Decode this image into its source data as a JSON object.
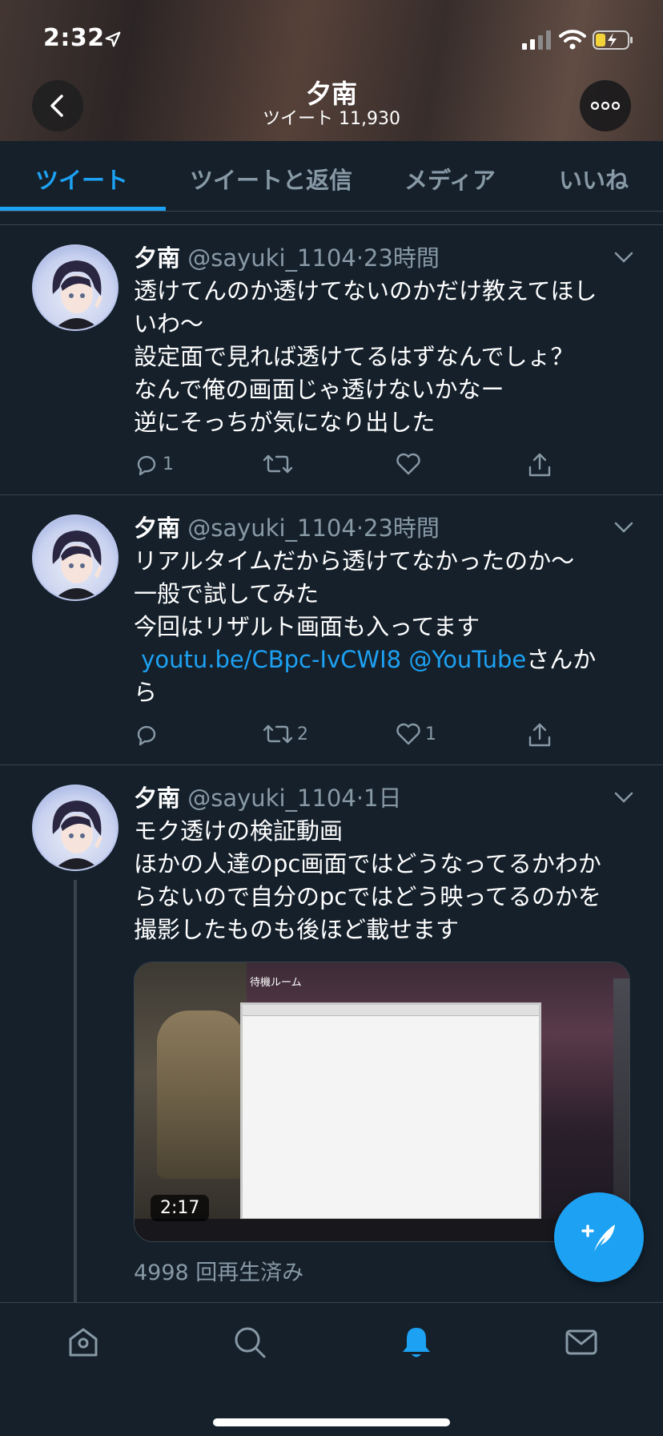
{
  "status_bar": {
    "time": "2:32"
  },
  "profile": {
    "name": "夕南",
    "tweet_count_label": "ツイート 11,930"
  },
  "tabs": [
    {
      "label": "ツイート",
      "active": true
    },
    {
      "label": "ツイートと返信",
      "active": false
    },
    {
      "label": "メディア",
      "active": false
    },
    {
      "label": "いいね",
      "active": false
    }
  ],
  "tweets": [
    {
      "name": "夕南",
      "handle": "@sayuki_1104",
      "time": "23時間",
      "lines": [
        "透けてんのか透けてないのかだけ教えてほし",
        "いわ〜",
        "設定面で見れば透けてるはずなんでしょ？",
        "なんで俺の画面じゃ透けないかなー",
        "逆にそっちが気になり出した"
      ],
      "replies": "1",
      "retweets": "",
      "likes": ""
    },
    {
      "name": "夕南",
      "handle": "@sayuki_1104",
      "time": "23時間",
      "lines": [
        "リアルタイムだから透けてなかったのか〜",
        "一般で試してみた",
        "今回はリザルト画面も入ってます"
      ],
      "link_line": {
        "link1": "youtu.be/CBpc-IvCWI8",
        "link2": "@YouTube",
        "suffix": "さんか"
      },
      "last_line": "ら",
      "replies": "",
      "retweets": "2",
      "likes": "1"
    },
    {
      "name": "夕南",
      "handle": "@sayuki_1104",
      "time": "1日",
      "lines": [
        "モク透けの検証動画",
        "ほかの人達のpc画面ではどうなってるかわか",
        "らないので自分のpcではどう映ってるのかを",
        "撮影したものも後ほど載せます"
      ],
      "media": {
        "duration": "2:17",
        "room_label": "待機ルーム"
      },
      "views": "4998 回再生済み"
    }
  ],
  "colors": {
    "accent": "#1da1f2",
    "background": "#15202b",
    "muted": "#8899a6",
    "divider": "#38444d"
  },
  "icons": [
    "back-icon",
    "more-icon",
    "chevron-down-icon",
    "reply-icon",
    "retweet-icon",
    "like-icon",
    "share-icon",
    "compose-icon",
    "home-icon",
    "search-icon",
    "notifications-icon",
    "messages-icon"
  ]
}
